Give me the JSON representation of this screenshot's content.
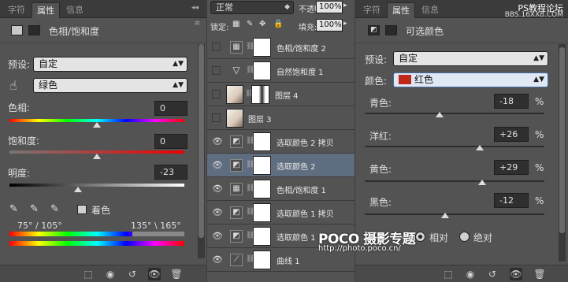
{
  "panel1": {
    "tabs": [
      "字符",
      "属性",
      "信息"
    ],
    "title": "色相/饱和度",
    "preset_label": "预设:",
    "preset_value": "自定",
    "channel_value": "绿色",
    "hue_label": "色相:",
    "hue_value": "0",
    "sat_label": "饱和度:",
    "sat_value": "0",
    "light_label": "明度:",
    "light_value": "-23",
    "colorize_label": "着色",
    "range_left": "75° / 105°",
    "range_right": "135° \\ 165°"
  },
  "panel2": {
    "blend_mode": "正常",
    "opacity_label": "不透明度:",
    "opacity_value": "100%",
    "lock_label": "锁定:",
    "fill_label": "填充:",
    "fill_value": "100%",
    "layers": [
      {
        "name": "色相/饱和度 2",
        "visible": false,
        "kind": "adjustment"
      },
      {
        "name": "自然饱和度 1",
        "visible": false,
        "kind": "adjustment"
      },
      {
        "name": "图层 4",
        "visible": false,
        "kind": "photo-mask"
      },
      {
        "name": "图层 3",
        "visible": false,
        "kind": "photo"
      },
      {
        "name": "选取颜色 2 拷贝",
        "visible": true,
        "kind": "adjustment"
      },
      {
        "name": "选取颜色 2",
        "visible": true,
        "kind": "adjustment",
        "active": true
      },
      {
        "name": "色相/饱和度 1",
        "visible": true,
        "kind": "adjustment"
      },
      {
        "name": "选取颜色 1 拷贝",
        "visible": true,
        "kind": "adjustment"
      },
      {
        "name": "选取颜色 1",
        "visible": true,
        "kind": "adjustment"
      },
      {
        "name": "曲线 1",
        "visible": true,
        "kind": "adjustment"
      }
    ]
  },
  "panel3": {
    "tabs": [
      "字符",
      "属性",
      "信息"
    ],
    "title": "可选颜色",
    "watermark_top": "PS教程论坛",
    "watermark_url": "BBS.16XX8.COM",
    "preset_label": "预设:",
    "preset_value": "自定",
    "colors_label": "颜色:",
    "colors_value": "红色",
    "swatch": "#c0281a",
    "cyan_label": "青色:",
    "cyan_value": "-18",
    "magenta_label": "洋红:",
    "magenta_value": "+26",
    "yellow_label": "黄色:",
    "yellow_value": "+29",
    "black_label": "黑色:",
    "black_value": "-12",
    "percent": "%",
    "relative_label": "相对",
    "absolute_label": "绝对"
  },
  "watermark": {
    "brand": "POCO 摄影专题",
    "url": "http://photo.poco.cn/"
  }
}
